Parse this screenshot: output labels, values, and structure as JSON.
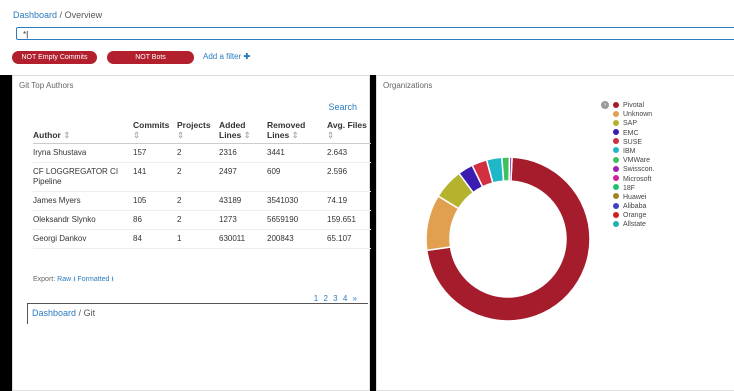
{
  "breadcrumb": {
    "parent": "Dashboard",
    "separator": "/",
    "current": "Overview"
  },
  "query": {
    "value": "*"
  },
  "filters": [
    {
      "label": "NOT Empty Commits"
    },
    {
      "label": "NOT Bots"
    }
  ],
  "add_filter": {
    "label": "Add a filter",
    "icon": "plus-icon"
  },
  "authors_panel": {
    "title": "Git Top Authors",
    "search_label": "Search",
    "columns": [
      "Author",
      "Commits",
      "Projects",
      "Added Lines",
      "Removed Lines",
      "Avg. Files"
    ],
    "rows": [
      [
        "Iryna Shustava",
        "157",
        "2",
        "2316",
        "3441",
        "2.643"
      ],
      [
        "CF LOGGREGATOR CI Pipeline",
        "141",
        "2",
        "2497",
        "609",
        "2.596"
      ],
      [
        "James Myers",
        "105",
        "2",
        "43189",
        "3541030",
        "74.19"
      ],
      [
        "Oleksandr Slynko",
        "86",
        "2",
        "1273",
        "5659190",
        "159.651"
      ],
      [
        "Georgi Dankov",
        "84",
        "1",
        "630011",
        "200843",
        "65.107"
      ]
    ],
    "export_label": "Export:",
    "export_raw": "Raw",
    "export_formatted": "Formatted",
    "pages": [
      "1",
      "2",
      "3",
      "4",
      "»"
    ]
  },
  "org_panel": {
    "title": "Organizations",
    "legend": [
      {
        "name": "Pivotal",
        "color": "#a51d2d"
      },
      {
        "name": "Unknown",
        "color": "#e0a050"
      },
      {
        "name": "SAP",
        "color": "#b5b32e"
      },
      {
        "name": "EMC",
        "color": "#3a1cb0"
      },
      {
        "name": "SUSE",
        "color": "#d03040"
      },
      {
        "name": "IBM",
        "color": "#1eb8c8"
      },
      {
        "name": "VMWare",
        "color": "#3cc060"
      },
      {
        "name": "Swisscon.",
        "color": "#a020b0"
      },
      {
        "name": "Microsoft",
        "color": "#d020a0"
      },
      {
        "name": "18F",
        "color": "#20c070"
      },
      {
        "name": "Huawei",
        "color": "#a08020"
      },
      {
        "name": "Alibaba",
        "color": "#4040c0"
      },
      {
        "name": "Orange",
        "color": "#d02020"
      },
      {
        "name": "Allstate",
        "color": "#20b0b0"
      }
    ]
  },
  "chart_data": {
    "type": "pie",
    "donut": true,
    "categories": [
      "Pivotal",
      "Unknown",
      "SAP",
      "EMC",
      "SUSE",
      "IBM",
      "VMWare",
      "Swisscon."
    ],
    "values": [
      72,
      11,
      6,
      3,
      3,
      3,
      1.5,
      0.5
    ]
  },
  "sub_breadcrumb": {
    "parent": "Dashboard",
    "separator": "/",
    "current": "Git"
  }
}
